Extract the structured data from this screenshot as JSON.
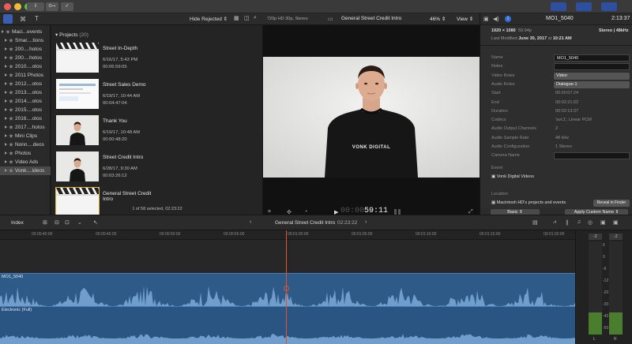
{
  "titlebar": {
    "buttons": [
      "",
      "",
      ""
    ],
    "keyword_badge": "O⊶",
    "right_buttons": [
      "",
      "",
      ""
    ]
  },
  "toolbar": {
    "hide_rejected": "Hide Rejected",
    "viewer_format": "720p HD 30p, Stereo",
    "viewer_title": "General Street Credit Intro",
    "zoom": "46%",
    "view_menu": "View"
  },
  "inspector": {
    "clip_name": "MO1_5040",
    "duration_display": "2:13:37",
    "resolution": "1920 × 1080",
    "bitrate": "59.94p",
    "audio": "Stereo | 48kHz",
    "modified_label": "Last Modified",
    "modified_date": "June 30, 2017",
    "modified_at": "at",
    "modified_time": "10:21 AM",
    "rows": [
      {
        "label": "Name",
        "value": "MO1_5040",
        "kind": "field"
      },
      {
        "label": "Notes",
        "value": "",
        "kind": "field"
      },
      {
        "label": "Video Roles",
        "value": "Video",
        "kind": "popup"
      },
      {
        "label": "Audio Roles",
        "value": "Dialogue-1",
        "kind": "popup"
      },
      {
        "label": "Start",
        "value": "00:00:07:24",
        "kind": "text"
      },
      {
        "label": "End",
        "value": "00:02:21:02",
        "kind": "text"
      },
      {
        "label": "Duration",
        "value": "00:02:13:37",
        "kind": "text"
      },
      {
        "label": "Codecs",
        "value": "'avc1', Linear PCM",
        "kind": "text"
      },
      {
        "label": "Audio Output Channels",
        "value": "2",
        "kind": "text"
      },
      {
        "label": "Audio Sample Rate",
        "value": "48 kHz",
        "kind": "text"
      },
      {
        "label": "Audio Configuration",
        "value": "1 Stereo",
        "kind": "text"
      },
      {
        "label": "Camera Name",
        "value": "",
        "kind": "field"
      }
    ],
    "event_label": "Event",
    "event_value": "Vonk Digital Videos",
    "location_label": "Location",
    "location_value": "Macintosh HD's projects and events",
    "reveal_button": "Reveal in Finder",
    "basic_popup": "Basic",
    "apply_button": "Apply Custom Name"
  },
  "sidebar": {
    "items": [
      {
        "label": "Maci...events",
        "kind": "library",
        "selected": false
      },
      {
        "label": "Smar....tions",
        "kind": "folder",
        "selected": false
      },
      {
        "label": "200....hotos",
        "kind": "event",
        "selected": false
      },
      {
        "label": "200....hotos",
        "kind": "event",
        "selected": false
      },
      {
        "label": "2010....otos",
        "kind": "event",
        "selected": false
      },
      {
        "label": "2011 Photos",
        "kind": "event",
        "selected": false
      },
      {
        "label": "2012....otos",
        "kind": "event",
        "selected": false
      },
      {
        "label": "2013....otos",
        "kind": "event",
        "selected": false
      },
      {
        "label": "2014....otos",
        "kind": "event",
        "selected": false
      },
      {
        "label": "2015....otos",
        "kind": "event",
        "selected": false
      },
      {
        "label": "2016....otos",
        "kind": "event",
        "selected": false
      },
      {
        "label": "2017....hotos",
        "kind": "event",
        "selected": false
      },
      {
        "label": "Mini Clips",
        "kind": "event",
        "selected": false
      },
      {
        "label": "Nonn....deos",
        "kind": "event",
        "selected": false
      },
      {
        "label": "Photos",
        "kind": "event",
        "selected": false
      },
      {
        "label": "Video Ads",
        "kind": "event",
        "selected": false
      },
      {
        "label": "Vonk....ideos",
        "kind": "event",
        "selected": true
      }
    ]
  },
  "browser": {
    "section_title": "Projects",
    "section_count": "(20)",
    "clips": [
      {
        "title": "Street In-Depth",
        "date": "6/16/17, 5:43 PM",
        "duration": "00:06:59:05",
        "thumb": "clapper"
      },
      {
        "title": "Street Sales Demo",
        "date": "6/19/17, 10:44 AM",
        "duration": "00:04:47:04",
        "thumb": "screen"
      },
      {
        "title": "Thank You",
        "date": "6/19/17, 10:48 AM",
        "duration": "00:00:48:20",
        "thumb": "person"
      },
      {
        "title": "Street Credit Intro",
        "date": "6/28/17, 9:30 AM",
        "duration": "00:03:26:12",
        "thumb": "person"
      },
      {
        "title": "General Street Credit Intro",
        "date": "",
        "duration": "",
        "thumb": "clapper"
      }
    ],
    "status": "1 of 58 selected, 02:23:22"
  },
  "viewer": {
    "shirt_text": "VONK DIGITAL",
    "timecode_dim": "00:00:0",
    "timecode": "59:11"
  },
  "timeline": {
    "index_label": "Index",
    "project_name": "General Street Credit Intro",
    "project_duration": "02:23:22",
    "ruler_ticks": [
      "00:00:40:00",
      "00:00:45:00",
      "00:00:50:00",
      "00:00:55:00",
      "00:01:00:00",
      "00:01:05:00",
      "00:01:10:00",
      "00:01:15:00",
      "00:01:20:00"
    ],
    "track1_name": "MO1_5040",
    "track2_name": "Electronic (Full)",
    "meter_labels": [
      "6",
      "0",
      "-6",
      "-12",
      "-20",
      "-30",
      "-40",
      "-50"
    ],
    "meter_channels": [
      "L",
      "R"
    ],
    "meter_peaks": [
      "-2",
      "-2"
    ]
  },
  "colors": {
    "accent": "#2f6fd9",
    "audio_clip": "#2d5a86",
    "waveform": "#6f9dcc",
    "playhead": "#e0532c",
    "meter_green": "#4a7d2e"
  }
}
